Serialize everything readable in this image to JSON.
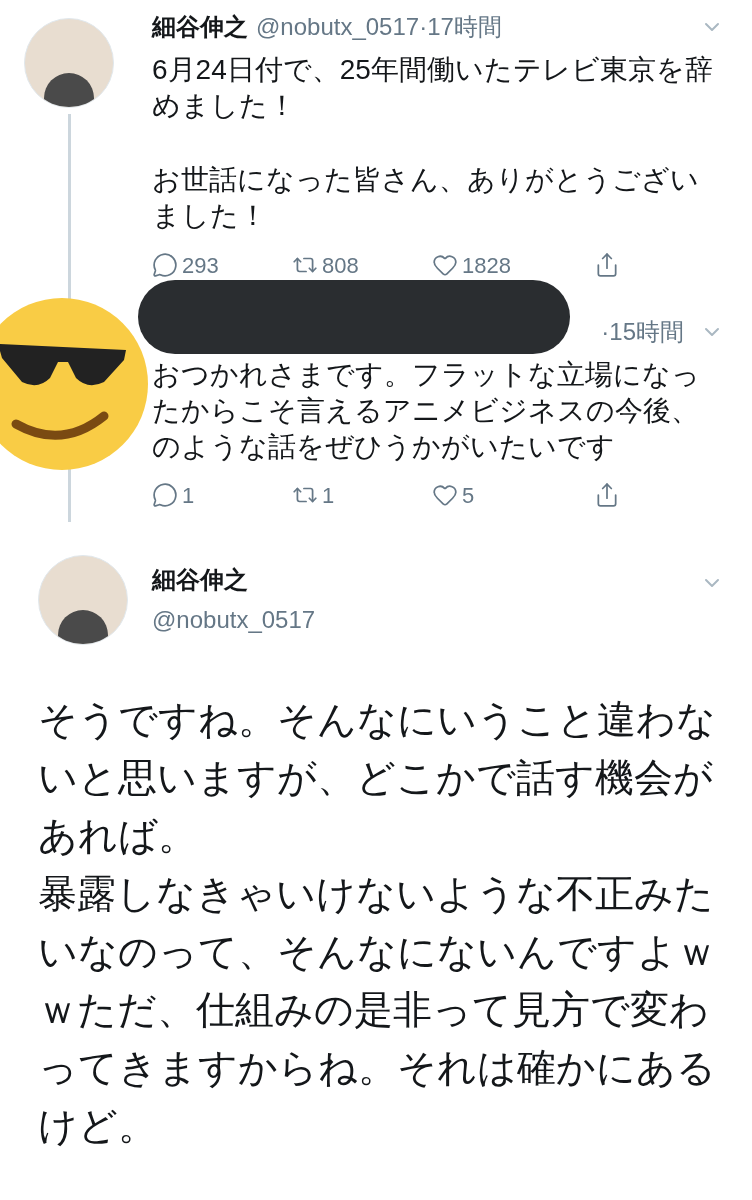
{
  "tweets": [
    {
      "kind": "thread",
      "redacted": false,
      "name": "細谷伸之",
      "handle": "@nobutx_0517",
      "time": "·17時間",
      "paragraphs": [
        "6月24日付で、25年間働いたテレビ東京を辞めました！",
        "お世話になった皆さん、ありがとうございました！"
      ],
      "counts": [
        "293",
        "808",
        "1828"
      ]
    },
    {
      "kind": "thread",
      "redacted": true,
      "time": "·15時間",
      "paragraphs": [
        "おつかれさまです。フラットな立場になったからこそ言えるアニメビジネスの今後、のような話をぜひうかがいたいです"
      ],
      "counts": [
        "1",
        "1",
        "5"
      ]
    },
    {
      "kind": "main",
      "redacted": false,
      "name": "細谷伸之",
      "handle": "@nobutx_0517",
      "paragraphs": [
        "そうですね。そんなにいうこと違わないと思いますが、どこかで話す機会があれば。",
        "暴露しなきゃいけないような不正みたいなのって、そんなにないんですよｗｗただ、仕組みの是非って見方で変わってきますからね。それは確かにあるけど。"
      ]
    }
  ]
}
